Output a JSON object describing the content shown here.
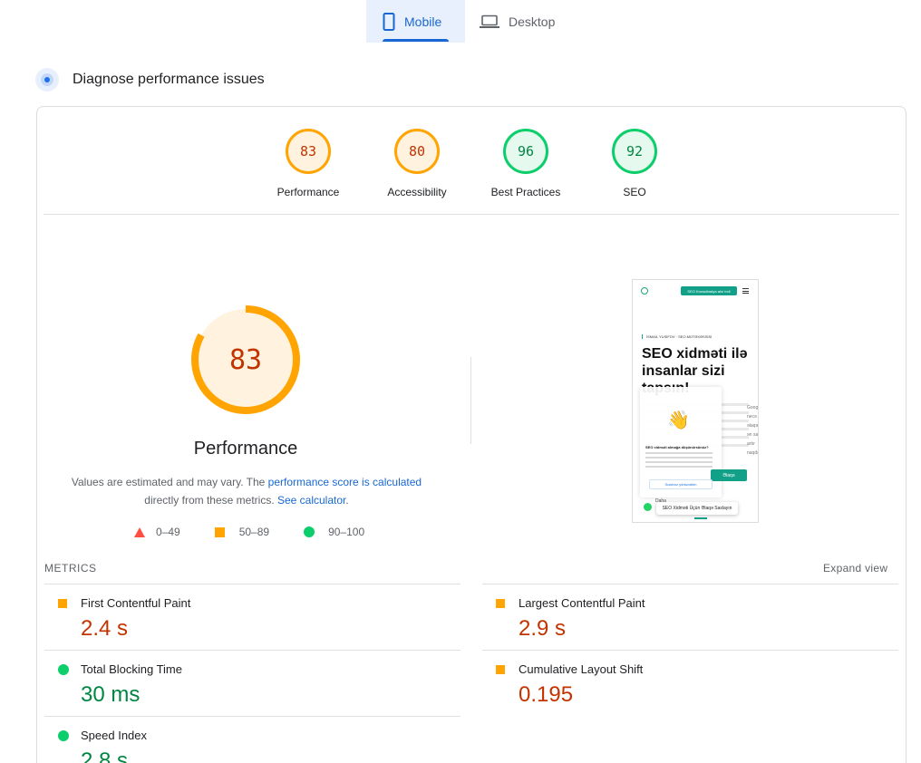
{
  "tabs": [
    {
      "label": "Mobile",
      "icon": "smartphone-icon",
      "active": true
    },
    {
      "label": "Desktop",
      "icon": "laptop-icon",
      "active": false
    }
  ],
  "diagnose": {
    "title": "Diagnose performance issues",
    "icon": "diagnose-icon"
  },
  "scores": [
    {
      "value": "83",
      "label": "Performance",
      "status": "average"
    },
    {
      "value": "80",
      "label": "Accessibility",
      "status": "average"
    },
    {
      "value": "96",
      "label": "Best Practices",
      "status": "pass"
    },
    {
      "value": "92",
      "label": "SEO",
      "status": "pass"
    }
  ],
  "performance": {
    "score": "83",
    "score_fraction": 0.83,
    "title": "Performance",
    "note_prefix": "Values are estimated and may vary. The ",
    "note_link": "performance score is calculated",
    "note_middle": "directly from these metrics. ",
    "calc_link": "See calculator",
    "note_suffix": "."
  },
  "legend": [
    {
      "range": "0–49",
      "shape": "triangle",
      "color": "#ff4e42"
    },
    {
      "range": "50–89",
      "shape": "square",
      "color": "#ffa400"
    },
    {
      "range": "90–100",
      "shape": "circle",
      "color": "#0cce6b"
    }
  ],
  "screenshot": {
    "cta": "SEO Konsultasiya alın indi",
    "kicker": "İSMAİL YUSİFOV · SEO MÜTƏXƏSSİSİ",
    "headline": "SEO xidməti ilə insanlar sizi tapsın!",
    "side_words": [
      "Google",
      "necə",
      "əlaqəl",
      "ən sayl",
      "artır",
      "naqda"
    ],
    "popup_question": "SEO xidməti almağa düşünürsünüz?",
    "green_button": "Əlaqə",
    "chat_button": "Sualınız yönləndirin",
    "whatsapp_label": "Daha",
    "bottom_pill": "SEO Xidməti Üçün Əlaqə Saxlayın"
  },
  "metrics": {
    "heading": "METRICS",
    "expand_label": "Expand view",
    "items": [
      {
        "name": "First Contentful Paint",
        "value": "2.4 s",
        "status": "average"
      },
      {
        "name": "Largest Contentful Paint",
        "value": "2.9 s",
        "status": "average"
      },
      {
        "name": "Total Blocking Time",
        "value": "30 ms",
        "status": "pass"
      },
      {
        "name": "Cumulative Layout Shift",
        "value": "0.195",
        "status": "average"
      },
      {
        "name": "Speed Index",
        "value": "2.8 s",
        "status": "pass"
      }
    ]
  },
  "colors": {
    "accent": "#1967d2",
    "orange": "#ffa400",
    "orange_text": "#c33300",
    "green": "#0cce6b",
    "green_text": "#018642",
    "red": "#ff4e42"
  }
}
